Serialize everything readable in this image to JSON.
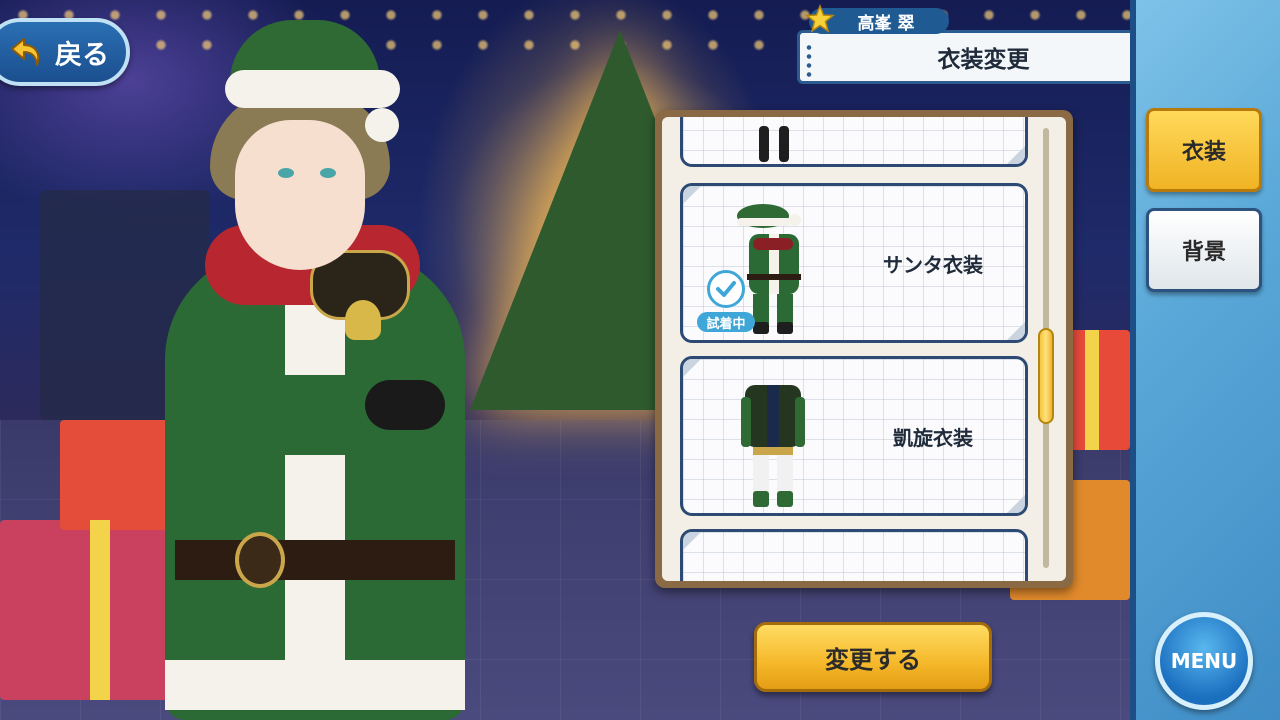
{
  "header": {
    "back_label": "戻る",
    "character_name": "高峯 翠",
    "screen_title": "衣装変更"
  },
  "sidebar": {
    "tabs": [
      {
        "label": "衣装",
        "selected": true
      },
      {
        "label": "背景",
        "selected": false
      }
    ],
    "menu_label": "MENU"
  },
  "costume_list": {
    "items": [
      {
        "label": ""
      },
      {
        "label": "サンタ衣装",
        "trying_on": true,
        "trying_on_label": "試着中"
      },
      {
        "label": "凱旋衣装"
      },
      {
        "label": ""
      }
    ]
  },
  "actions": {
    "change_label": "変更する"
  },
  "colors": {
    "accent_gold": "#f5b82a",
    "frame_blue": "#2c4a73",
    "tryon_blue": "#3fa6d8"
  },
  "icons": [
    "back-arrow-icon",
    "star-icon",
    "checkmark-icon"
  ]
}
